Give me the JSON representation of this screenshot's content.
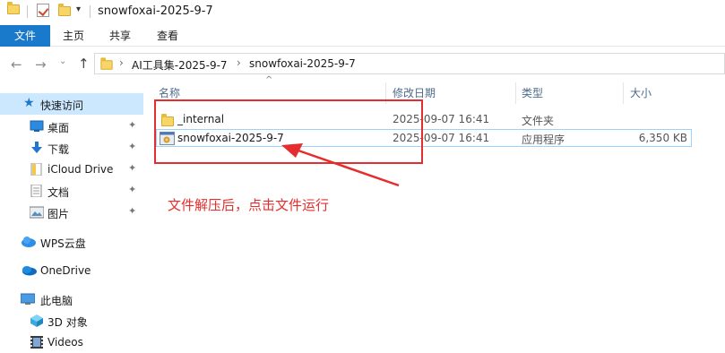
{
  "window": {
    "title": "snowfoxai-2025-9-7"
  },
  "ribbon": {
    "tabs": [
      "文件",
      "主页",
      "共享",
      "查看"
    ]
  },
  "address": {
    "crumbs": [
      "AI工具集-2025-9-7",
      "snowfoxai-2025-9-7"
    ]
  },
  "sidebar": {
    "items": [
      {
        "label": "快速访问",
        "icon": "star-icon"
      },
      {
        "label": "桌面",
        "icon": "desktop-icon"
      },
      {
        "label": "下载",
        "icon": "download-icon"
      },
      {
        "label": "iCloud Drive",
        "icon": "icloud-icon"
      },
      {
        "label": "文档",
        "icon": "document-icon"
      },
      {
        "label": "图片",
        "icon": "picture-icon"
      },
      {
        "label": "WPS云盘",
        "icon": "wps-cloud-icon"
      },
      {
        "label": "OneDrive",
        "icon": "onedrive-icon"
      },
      {
        "label": "此电脑",
        "icon": "computer-icon"
      },
      {
        "label": "3D 对象",
        "icon": "3d-objects-icon"
      },
      {
        "label": "Videos",
        "icon": "videos-icon"
      }
    ]
  },
  "columns": {
    "name": "名称",
    "date": "修改日期",
    "type": "类型",
    "size": "大小"
  },
  "files": [
    {
      "name": "_internal",
      "date": "2025-09-07 16:41",
      "type": "文件夹",
      "size": "",
      "icon": "folder-icon"
    },
    {
      "name": "snowfoxai-2025-9-7",
      "date": "2025-09-07 16:41",
      "type": "应用程序",
      "size": "6,350 KB",
      "icon": "application-icon"
    }
  ],
  "annotation": {
    "text": "文件解压后，点击文件运行",
    "color": "#e52d2d"
  },
  "colors": {
    "accent": "#1979ca",
    "selection": "#cce8ff"
  }
}
